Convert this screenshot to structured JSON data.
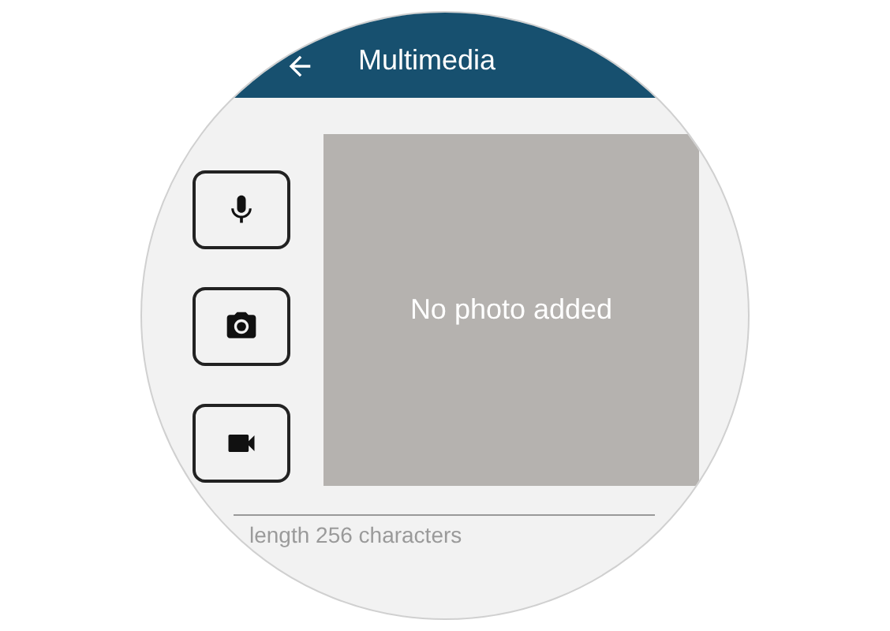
{
  "header": {
    "title": "Multimedia"
  },
  "media_buttons": [
    {
      "kind": "microphone"
    },
    {
      "kind": "camera"
    },
    {
      "kind": "video"
    }
  ],
  "photo": {
    "placeholder": "No photo added"
  },
  "field": {
    "helper": "length 256 characters"
  }
}
